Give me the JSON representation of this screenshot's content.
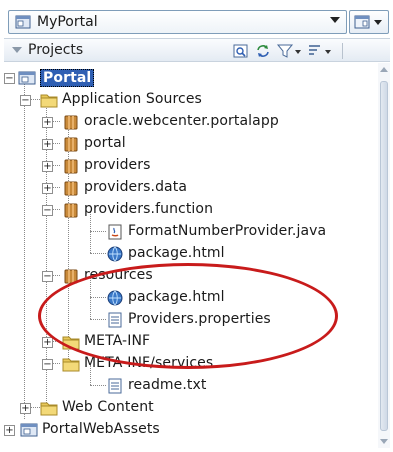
{
  "app": {
    "project_selector": "MyPortal",
    "panel_title": "Projects"
  },
  "colors": {
    "selection": "#2f5fb3",
    "annotation_ellipse": "#c81b1b",
    "folder": "#e8c85a",
    "package": "#c98a3a"
  },
  "icons": {
    "project_selector": "portal-project-icon",
    "navigator": "navigator-icon",
    "sync": "sync-icon",
    "filter": "filter-icon",
    "sort": "sort-icon",
    "package": "package-icon",
    "folder": "folder-icon",
    "java": "java-file-icon",
    "html": "html-file-icon",
    "text": "text-file-icon",
    "project": "project-icon"
  },
  "tree": {
    "items": [
      {
        "label": "Portal",
        "toggle": "-",
        "icon": "project",
        "selected": true
      },
      {
        "label": "Application Sources",
        "toggle": "-",
        "icon": "folder"
      },
      {
        "label": "oracle.webcenter.portalapp",
        "toggle": "+",
        "icon": "package"
      },
      {
        "label": "portal",
        "toggle": "+",
        "icon": "package"
      },
      {
        "label": "providers",
        "toggle": "+",
        "icon": "package"
      },
      {
        "label": "providers.data",
        "toggle": "+",
        "icon": "package"
      },
      {
        "label": "providers.function",
        "toggle": "-",
        "icon": "package"
      },
      {
        "label": "FormatNumberProvider.java",
        "toggle": "",
        "icon": "java"
      },
      {
        "label": "package.html",
        "toggle": "",
        "icon": "html"
      },
      {
        "label": "resources",
        "toggle": "-",
        "icon": "package"
      },
      {
        "label": "package.html",
        "toggle": "",
        "icon": "html"
      },
      {
        "label": "Providers.properties",
        "toggle": "",
        "icon": "text"
      },
      {
        "label": "META-INF",
        "toggle": "+",
        "icon": "folder"
      },
      {
        "label": "META-INF/services",
        "toggle": "-",
        "icon": "folder"
      },
      {
        "label": "readme.txt",
        "toggle": "",
        "icon": "text"
      },
      {
        "label": "Web Content",
        "toggle": "+",
        "icon": "folder"
      },
      {
        "label": "PortalWebAssets",
        "toggle": "+",
        "icon": "project"
      }
    ]
  }
}
